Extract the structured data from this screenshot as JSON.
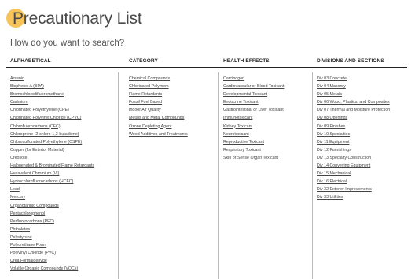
{
  "page": {
    "title": "Precautionary List",
    "subtitle": "How do you want to search?"
  },
  "columns": [
    {
      "header": "ALPHABETICAL",
      "items": [
        "Arsenic",
        "Bisphenol A (BPA)",
        "Bromochlorodifluoromethane",
        "Cadmium",
        "Chlorinated Polyethylene (CPE)",
        "Chlorinated Polyvinyl Chloride (CPVC)",
        "Chlorofluorocarbons (CFC)",
        "Chloroprene (2-chloro-1,3-butadiene)",
        "Chlorosulfonated Polyethylene (CSPE)",
        "Copper (for Exterior Material)",
        "Creosote",
        "Halogenated & Brominated Flame Retardants",
        "Hexavalent Chromium (VI)",
        "Hydrochlorofluorocarbons (HCFC)",
        "Lead",
        "Mercury",
        "Organotannic Compounds",
        "Pentachlorophenol",
        "Perfluorocarbons (PFC)",
        "Phthalates",
        "Polystyrene",
        "Polyurethane Foam",
        "Polyvinyl Chloride (PVC)",
        "Urea Formaldehyde",
        "Volatile Organic Compounds (VOCs)"
      ]
    },
    {
      "header": "CATEGORY",
      "items": [
        "Chemical Compounds",
        "Chlorinated Polymers",
        "Flame Retardants",
        "Fossil Fuel Based",
        "Indoor Air Quality",
        "Metals and Metal Compounds",
        "Ozone Depleting Agent",
        "Wood Additives and Treatments"
      ]
    },
    {
      "header": "HEALTH EFFECTS",
      "items": [
        "Carcinogen",
        "Cardiovascular or Blood Toxicant",
        "Developmental Toxicant",
        "Endocrine Toxicant",
        "Gastrointestinal or Liver Toxicant",
        "Immunotoxicant",
        "Kidney Toxicant",
        "Neurotoxicant",
        "Reproductive Toxicant",
        "Respiratory Toxicant",
        "Skin or Sense Organ Toxicant"
      ]
    },
    {
      "header": "DIVISIONS AND SECTIONS",
      "items": [
        "Div 03 Concrete",
        "Div 04 Masonry",
        "Div 05 Metals",
        "Div 06 Wood, Plastics, and Composites",
        "Div 07 Thermal and Moisture Protection",
        "Div 08 Openings",
        "Div 09 Finishes",
        "Div 10 Specialties",
        "Div 11 Equipment",
        "Div 12 Furnishings",
        "Div 13 Specialty Construction",
        "Div 14 Conveying Equipment",
        "Div 15 Mechanical",
        "Div 16 Electrical",
        "Div 32 Exterior Improvements",
        "Div 33 Utilities"
      ]
    }
  ],
  "colors": {
    "accent_circle": "#f6c45a",
    "rule": "#222222",
    "divider": "#bbbbbb"
  }
}
